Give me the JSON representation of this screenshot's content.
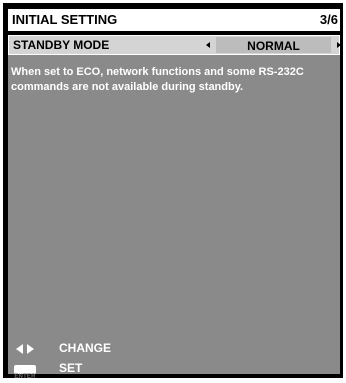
{
  "header": {
    "title": "INITIAL SETTING",
    "page_indicator": "3/6"
  },
  "menu": {
    "item_label": "STANDBY MODE",
    "value": "NORMAL"
  },
  "description": "When set to ECO, network functions and some RS-232C commands are not available during standby.",
  "guide": {
    "change_label": "CHANGE",
    "set_label": "SET",
    "enter_key_text": "ENTER",
    "icons": [
      "left-right-arrows-icon",
      "enter-key-icon"
    ]
  },
  "colors": {
    "frame": "#000000",
    "panel": "#8a8a8a",
    "row": "#d4d4d4",
    "value_box": "#bcbcbc",
    "text_light": "#ffffff"
  }
}
